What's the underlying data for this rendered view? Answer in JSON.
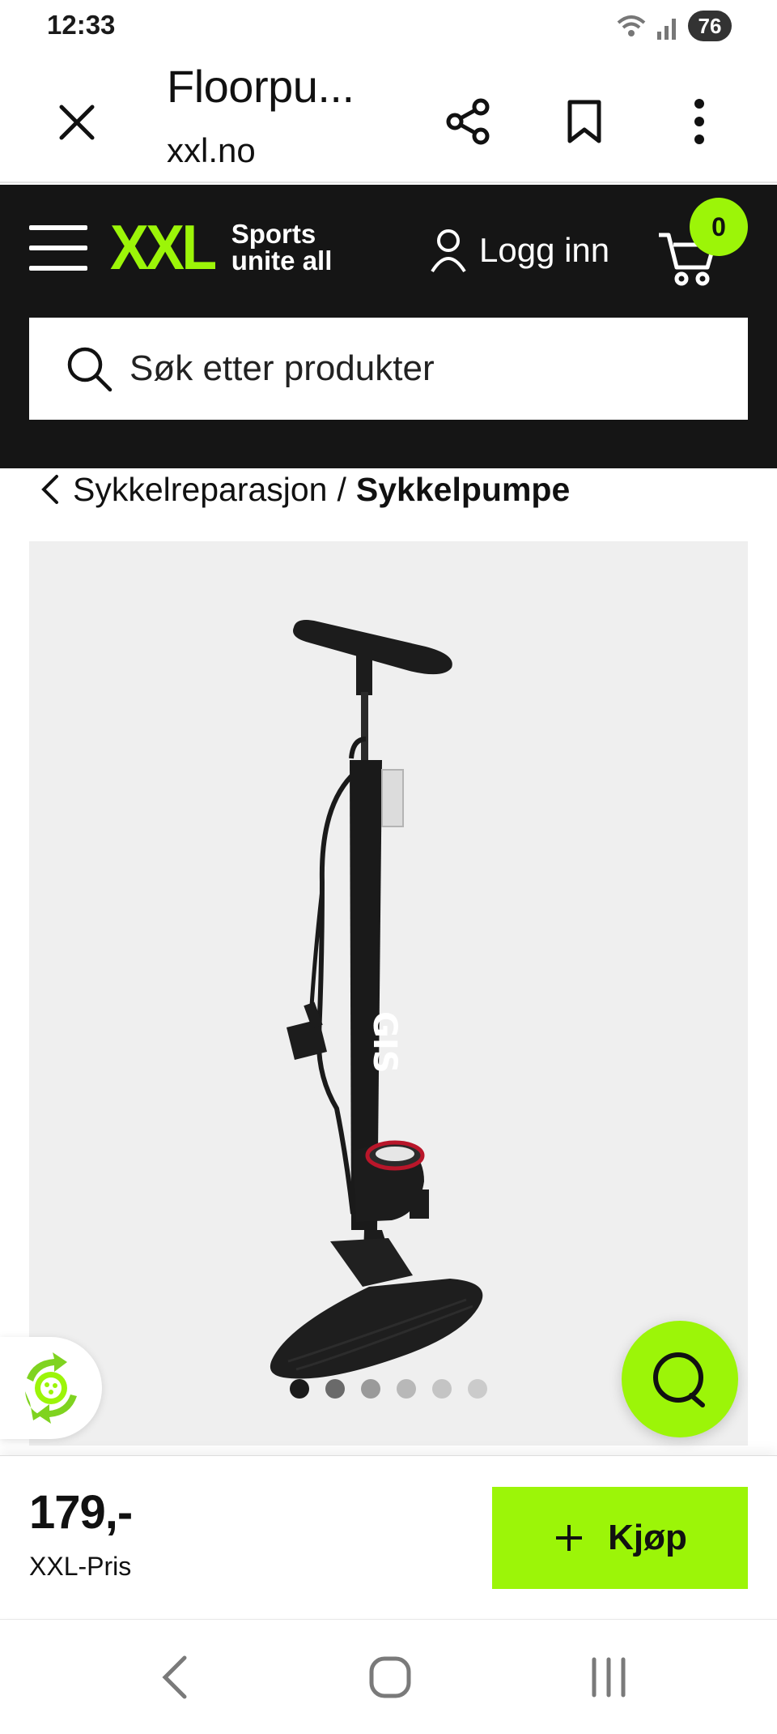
{
  "status_bar": {
    "time": "12:33",
    "battery": "76"
  },
  "tab": {
    "title": "Floorpu...",
    "url": "xxl.no"
  },
  "header": {
    "logo_text": "XXL",
    "logo_tagline_1": "Sports",
    "logo_tagline_2": "unite all",
    "login_label": "Logg inn",
    "cart_count": "0",
    "search_placeholder": "Søk etter produkter"
  },
  "breadcrumb": {
    "parent": "Sykkelreparasjon",
    "separator": "/",
    "current": "Sykkelpumpe"
  },
  "gallery": {
    "image_count": 6,
    "active_index": 0
  },
  "buy_bar": {
    "price": "179,-",
    "price_label": "XXL-Pris",
    "buy_label": "Kjøp"
  },
  "colors": {
    "brand_green": "#9cf508",
    "header_bg": "#151515"
  },
  "icons": [
    "close-icon",
    "share-icon",
    "bookmark-icon",
    "more-vert-icon",
    "menu-icon",
    "user-icon",
    "cart-icon",
    "search-icon",
    "chevron-left-icon",
    "recycle-icon",
    "chat-icon",
    "plus-icon",
    "nav-back-icon",
    "nav-home-icon",
    "nav-recents-icon"
  ]
}
